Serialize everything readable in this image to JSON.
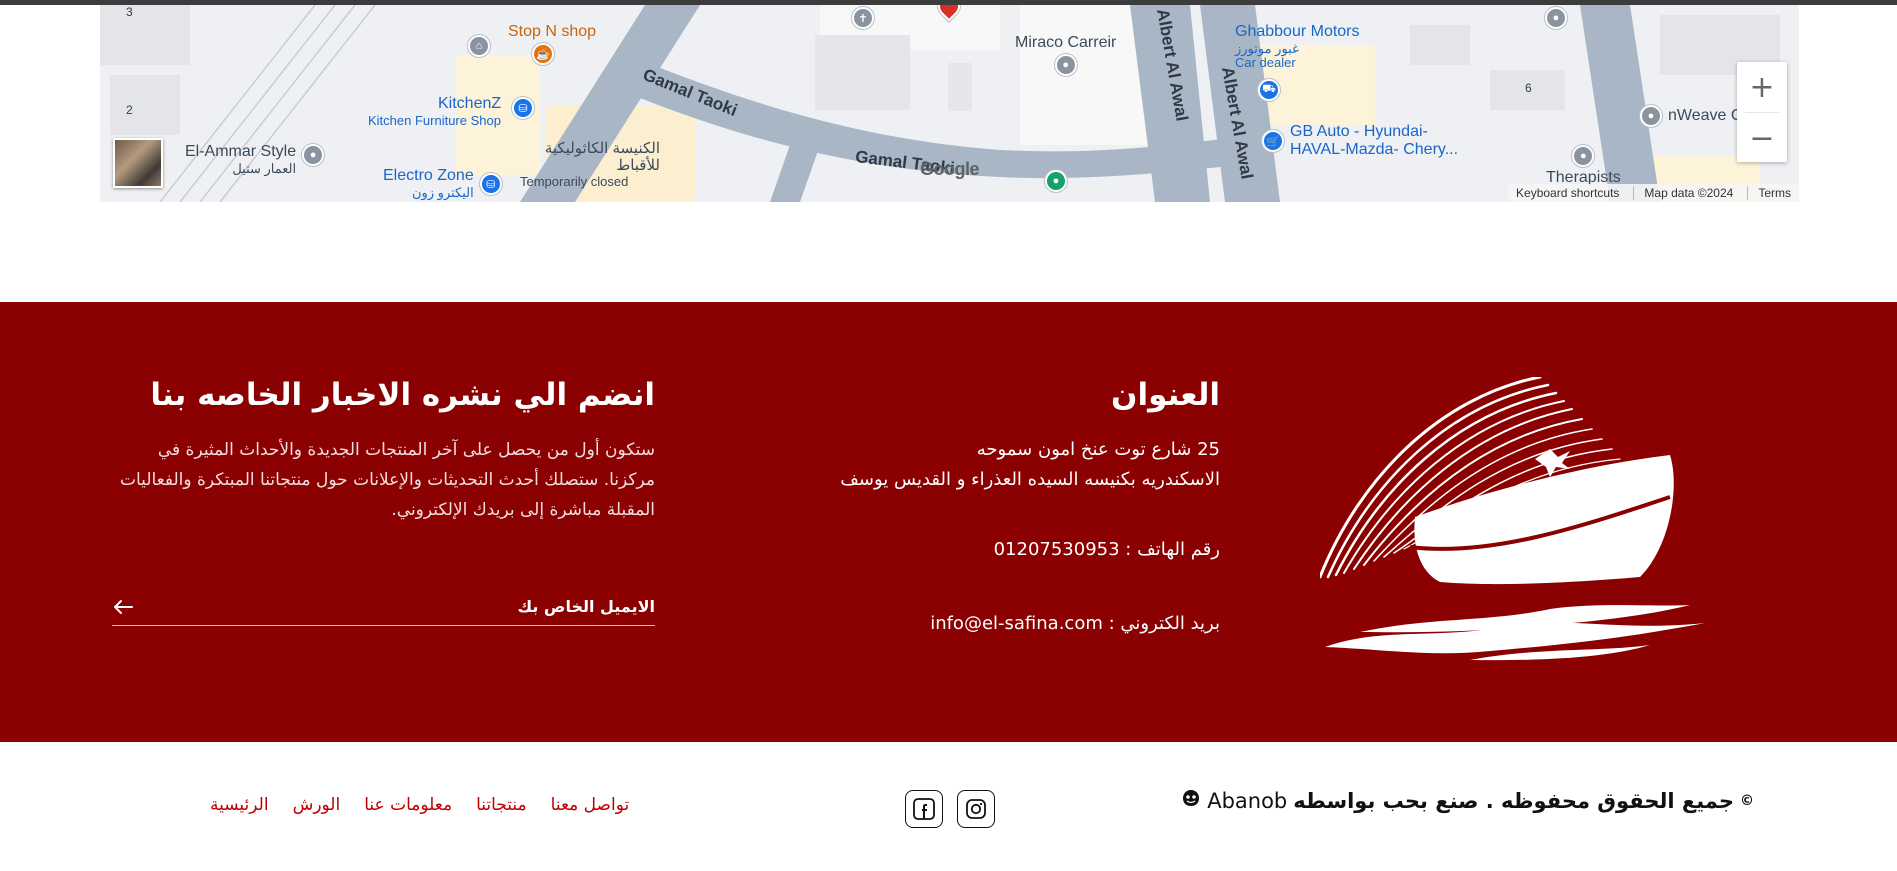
{
  "map": {
    "labels": {
      "stop_n_shop": "Stop N shop",
      "miraco": "Miraco Carreir",
      "ghabbour": "Ghabbour Motors",
      "ghabbour_ar": "غبور موتورز",
      "car_dealer": "Car dealer",
      "kitchenz": "KitchenZ",
      "kitchenz_sub": "Kitchen Furniture Shop",
      "el_ammar": "El-Ammar Style",
      "el_ammar_ar": "العمار ستيل",
      "electro_zone": "Electro Zone",
      "electro_zone_ar": "اليكترو زون",
      "church": "الكنيسة الكاثوليكية للأقباط",
      "temporarily_closed": "Temporarily closed",
      "gb_auto": "GB Auto - Hyundai-",
      "gb_auto_2": "HAVAL-Mazda- Chery...",
      "nweave": "nWeave C",
      "therapists": "Therapists",
      "gamal_taoki_1": "Gamal Taoki",
      "gamal_taoki_2": "Gamal Taoki",
      "albert_1": "Albert Al Awal",
      "albert_2": "Albert Al Awal",
      "num_3": "3",
      "num_2": "2",
      "num_6": "6"
    },
    "google_logo": "Google",
    "zoom_in": "+",
    "zoom_out": "−",
    "attribution": {
      "keyboard": "Keyboard shortcuts",
      "map_data": "Map data ©2024",
      "terms": "Terms"
    }
  },
  "footer": {
    "address": {
      "title": "العنوان",
      "line1": "25 شارع توت عنخ امون سموحه",
      "line2": "الاسكندريه  بكنيسه السيده العذراء و القديس يوسف",
      "phone": "رقم الهاتف : 01207530953",
      "email": "بريد الكتروني : info@el-safina.com"
    },
    "newsletter": {
      "title": "انضم الي نشره الاخبار الخاصه بنا",
      "text": "ستكون أول من يحصل على آخر المنتجات الجديدة والأحداث المثيرة في مركزنا. ستصلك أحدث التحديثات والإعلانات حول منتجاتنا المبتكرة والفعاليات المقبلة مباشرة إلى بريدك الإلكتروني.",
      "placeholder": "الايميل الخاص بك"
    }
  },
  "bottom": {
    "copyright": "جميع الحقوق محفوظه . صنع بحب بواسطه",
    "copyright_symbol": "©",
    "brand": "Abanob",
    "nav": [
      "الرئيسية",
      "الورش",
      "معلومات عنا",
      "منتجاتنا",
      "تواصل معنا"
    ]
  },
  "colors": {
    "footer_bg": "#8b0000",
    "nav_link": "#c00000"
  }
}
